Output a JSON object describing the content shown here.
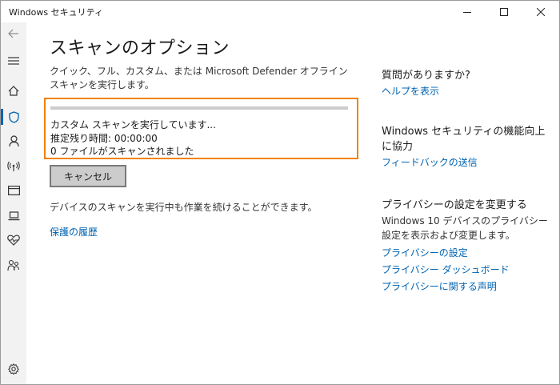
{
  "window": {
    "title": "Windows セキュリティ"
  },
  "sidebar": {
    "items": [
      {
        "icon": "back-arrow-icon"
      },
      {
        "icon": "menu-icon"
      },
      {
        "icon": "home-icon"
      },
      {
        "icon": "shield-icon",
        "selected": true
      },
      {
        "icon": "person-icon"
      },
      {
        "icon": "network-icon"
      },
      {
        "icon": "app-browser-icon"
      },
      {
        "icon": "laptop-icon"
      },
      {
        "icon": "heart-icon"
      },
      {
        "icon": "family-icon"
      },
      {
        "icon": "gear-icon"
      }
    ],
    "accent": "#0063b1"
  },
  "main": {
    "title": "スキャンのオプション",
    "description": "クイック、フル、カスタム、または Microsoft Defender オフライン スキャンを実行します。",
    "scan_status": {
      "line1": "カスタム スキャンを実行しています...",
      "line2": "推定残り時間: 00:00:00",
      "line3": "0 ファイルがスキャンされました",
      "progress": 0.0,
      "highlight_color": "#f08300"
    },
    "cancel_label": "キャンセル",
    "continue_text": "デバイスのスキャンを実行中も作業を続けることができます。",
    "history_link": "保護の履歴"
  },
  "right": {
    "help_heading": "質問がありますか?",
    "help_link": "ヘルプを表示",
    "improve_heading": "Windows セキュリティの機能向上に協力",
    "feedback_link": "フィードバックの送信",
    "privacy_heading": "プライバシーの設定を変更する",
    "privacy_text": "Windows 10 デバイスのプライバシー設定を表示および変更します。",
    "privacy_settings_link": "プライバシーの設定",
    "privacy_dashboard_link": "プライバシー ダッシュボード",
    "privacy_statement_link": "プライバシーに関する声明"
  },
  "colors": {
    "link": "#0063b1",
    "sidebar_bg": "#f2f2f2"
  }
}
